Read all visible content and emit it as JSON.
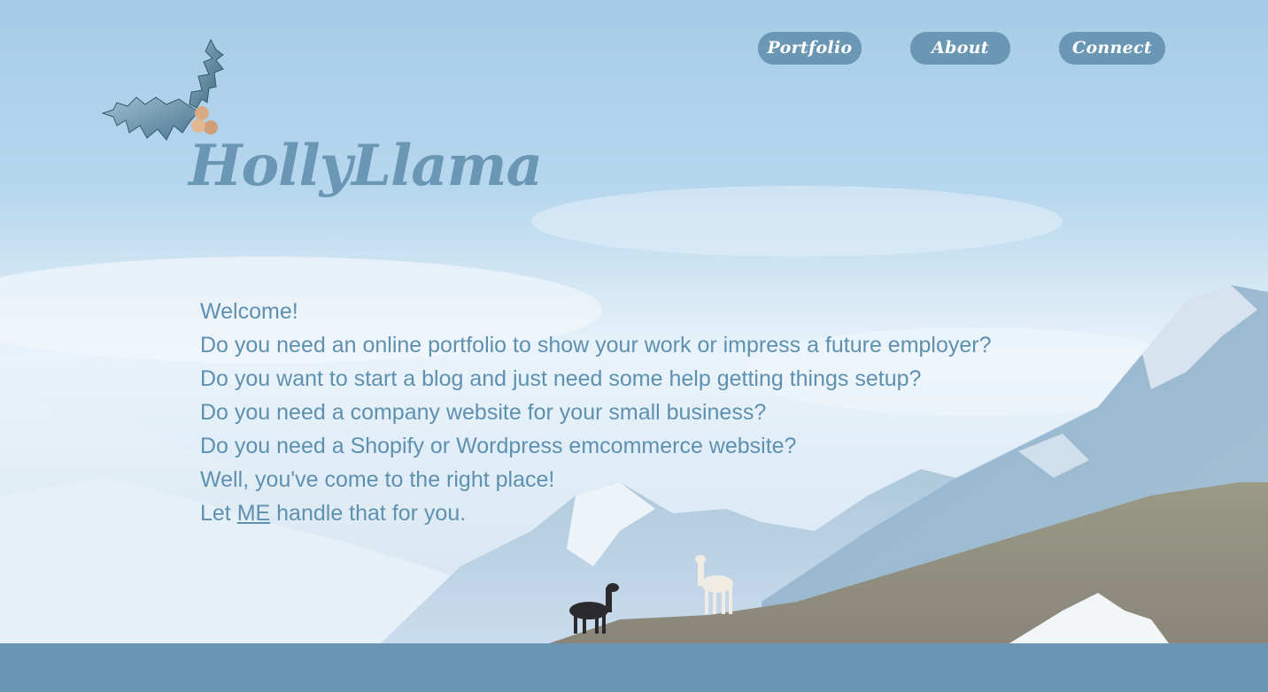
{
  "nav": {
    "portfolio": "Portfolio",
    "about": "About",
    "connect": "Connect"
  },
  "brand": {
    "name": "HollyLlama",
    "logo_icon": "holly-leaf-berries-icon"
  },
  "intro": {
    "lines": [
      "Welcome!",
      "Do you need an online portfolio to show your work or impress a future employer?",
      "Do you want to start a blog and just need some help getting things setup?",
      "Do you need a company website for your small business?",
      "Do you need a Shopify or Wordpress emcommerce website?",
      "Well, you've come to the right place!"
    ],
    "last_prefix": "Let ",
    "last_link": "ME",
    "last_suffix": " handle that for you."
  },
  "colors": {
    "accent": "#6a97b3",
    "text": "#5e90b0",
    "sky": "#a7cbe7"
  }
}
